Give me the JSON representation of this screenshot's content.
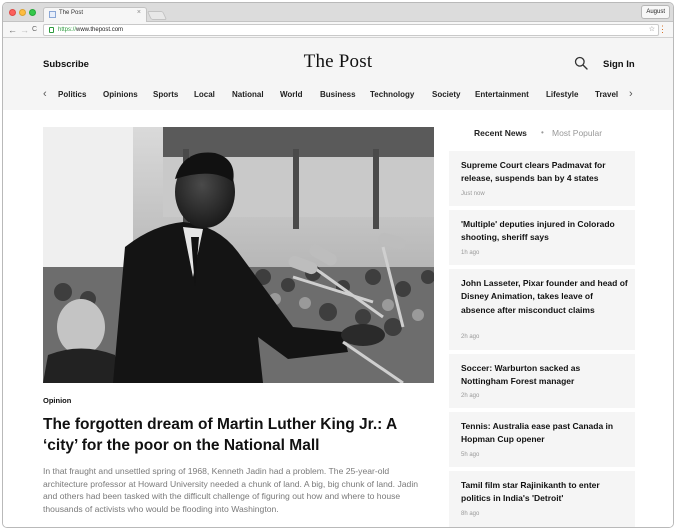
{
  "browser": {
    "tab_title": "The Post",
    "tab_close": "×",
    "profile_label": "August",
    "url_scheme": "https://",
    "url_host": "www.thepost.com",
    "back_icon": "←",
    "forward_icon": "→",
    "reload_icon": "C",
    "star_icon": "☆",
    "menu_icon": "⋮"
  },
  "header": {
    "subscribe": "Subscribe",
    "logo": "The Post",
    "signin": "Sign In"
  },
  "nav": {
    "prev_icon": "‹",
    "next_icon": "›",
    "items": [
      "Politics",
      "Opinions",
      "Sports",
      "Local",
      "National",
      "World",
      "Business",
      "Technology",
      "Society",
      "Entertainment",
      "Lifestyle",
      "Travel"
    ]
  },
  "article": {
    "kicker": "Opinion",
    "headline": "The forgotten dream of Martin Luther King Jr.: A ‘city’ for the poor on the National Mall",
    "summary": "In that fraught and unsettled spring of 1968, Kenneth Jadin had a problem. The 25-year-old architecture professor at Howard University needed a chunk of land. A big, big chunk of land. Jadin and others had been tasked with the difficult challenge of figuring out how and where to house thousands of activists who would be flooding into Washington."
  },
  "sidebar": {
    "tab_recent": "Recent News",
    "separator": "•",
    "tab_popular": "Most Popular",
    "items": [
      {
        "title": "Supreme Court clears Padmavat for release, suspends ban by 4 states",
        "time": "Just now"
      },
      {
        "title": "'Multiple' deputies injured in Colorado shooting, sheriff says",
        "time": "1h ago"
      },
      {
        "title": "John Lasseter, Pixar founder and head of Disney Animation, takes leave of absence after misconduct claims",
        "time": "2h ago"
      },
      {
        "title": "Soccer: Warburton sacked as Nottingham Forest manager",
        "time": "2h ago"
      },
      {
        "title": "Tennis: Australia ease past Canada in Hopman Cup opener",
        "time": "5h ago"
      },
      {
        "title": "Tamil film star Rajinikanth to enter politics in India's 'Detroit'",
        "time": "8h ago"
      }
    ]
  },
  "colors": {
    "header_bg": "#f5f5f5",
    "card_bg": "#f5f5f5",
    "text": "#111111",
    "muted": "#7a7a7a",
    "secure_green": "#2d9b3d"
  }
}
